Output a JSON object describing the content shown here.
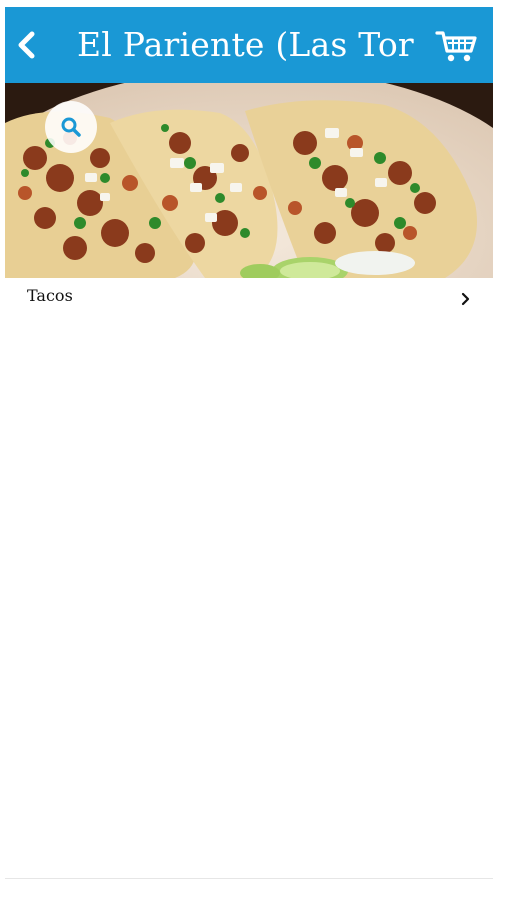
{
  "header": {
    "title": "El Pariente (Las Tor ...",
    "background_color": "#1a98d5",
    "back_icon": "chevron-left-icon",
    "cart_icon": "cart-icon"
  },
  "hero": {
    "search_icon": "search-icon"
  },
  "menu": {
    "items": [
      {
        "label": "Tacos",
        "icon": "chevron-right-icon"
      }
    ]
  }
}
